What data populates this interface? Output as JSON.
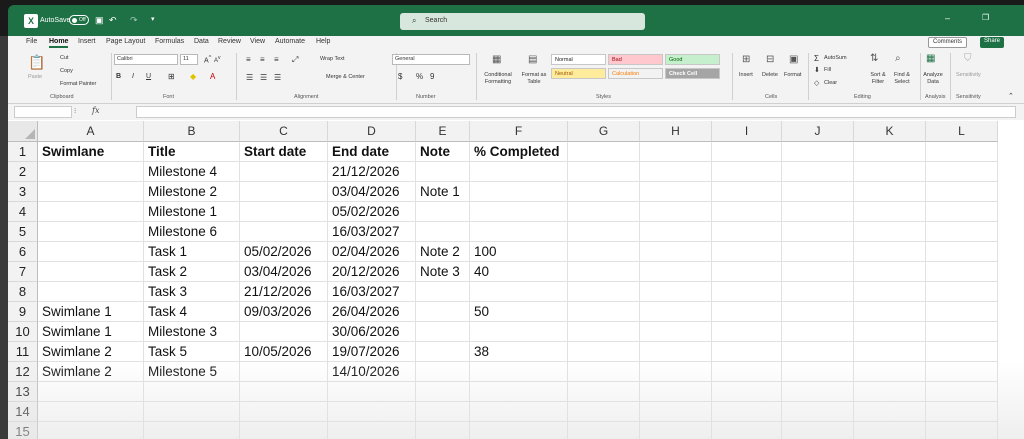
{
  "titlebar": {
    "autosave_label": "AutoSave",
    "toggle_state": "Off",
    "search_placeholder": "Search"
  },
  "menu": {
    "tabs": [
      "File",
      "Home",
      "Insert",
      "Page Layout",
      "Formulas",
      "Data",
      "Review",
      "View",
      "Automate",
      "Help"
    ],
    "active": "Home",
    "comments": "Comments",
    "share": "Share"
  },
  "ribbon": {
    "clipboard": {
      "paste": "Paste",
      "cut": "Cut",
      "copy": "Copy",
      "format_painter": "Format Painter",
      "label": "Clipboard"
    },
    "font": {
      "name": "Calibri",
      "size": "11",
      "label": "Font"
    },
    "alignment": {
      "wrap_text": "Wrap Text",
      "merge_center": "Merge & Center",
      "label": "Alignment"
    },
    "number": {
      "format": "General",
      "label": "Number"
    },
    "styles": {
      "conditional": "Conditional Formatting",
      "format_table": "Format as Table",
      "cells": [
        {
          "text": "Normal",
          "bg": "#ffffff",
          "fg": "#222222"
        },
        {
          "text": "Bad",
          "bg": "#ffc7ce",
          "fg": "#9c0006"
        },
        {
          "text": "Good",
          "bg": "#c6efce",
          "fg": "#006100"
        },
        {
          "text": "Neutral",
          "bg": "#ffeb9c",
          "fg": "#9c5700"
        },
        {
          "text": "Calculation",
          "bg": "#f2f2f2",
          "fg": "#fa7d00"
        },
        {
          "text": "Check Cell",
          "bg": "#a5a5a5",
          "fg": "#ffffff"
        }
      ],
      "label": "Styles"
    },
    "cells": {
      "insert": "Insert",
      "delete": "Delete",
      "format": "Format",
      "label": "Cells"
    },
    "editing": {
      "autosum": "AutoSum",
      "fill": "Fill",
      "clear": "Clear",
      "sort_filter": "Sort & Filter",
      "find_select": "Find & Select",
      "label": "Editing"
    },
    "analysis": {
      "analyze": "Analyze Data",
      "label": "Analysis"
    },
    "sensitivity": {
      "btn": "Sensitivity",
      "label": "Sensitivity"
    }
  },
  "formula_bar": {
    "fx": "fx",
    "value": ""
  },
  "sheet": {
    "columns": [
      "A",
      "B",
      "C",
      "D",
      "E",
      "F",
      "G",
      "H",
      "I",
      "J",
      "K",
      "L"
    ],
    "rows": [
      [
        "Swimlane",
        "Title",
        "Start date",
        "End date",
        "Note",
        "% Completed"
      ],
      [
        "",
        "Milestone 4",
        "",
        "21/12/2026",
        "",
        ""
      ],
      [
        "",
        "Milestone 2",
        "",
        "03/04/2026",
        "Note 1",
        ""
      ],
      [
        "",
        "Milestone 1",
        "",
        "05/02/2026",
        "",
        ""
      ],
      [
        "",
        "Milestone 6",
        "",
        "16/03/2027",
        "",
        ""
      ],
      [
        "",
        "Task 1",
        "05/02/2026",
        "02/04/2026",
        "Note 2",
        "100"
      ],
      [
        "",
        "Task 2",
        "03/04/2026",
        "20/12/2026",
        "Note 3",
        "40"
      ],
      [
        "",
        "Task 3",
        "21/12/2026",
        "16/03/2027",
        "",
        ""
      ],
      [
        "Swimlane 1",
        "Task 4",
        "09/03/2026",
        "26/04/2026",
        "",
        "50"
      ],
      [
        "Swimlane 1",
        "Milestone 3",
        "",
        "30/06/2026",
        "",
        ""
      ],
      [
        "Swimlane 2",
        "Task 5",
        "10/05/2026",
        "19/07/2026",
        "",
        "38"
      ],
      [
        "Swimlane 2",
        "Milestone 5",
        "",
        "14/10/2026",
        "",
        ""
      ],
      [
        "",
        "",
        "",
        "",
        "",
        ""
      ],
      [
        "",
        "",
        "",
        "",
        "",
        ""
      ],
      [
        "",
        "",
        "",
        "",
        "",
        ""
      ]
    ],
    "row_numbers": [
      "1",
      "2",
      "3",
      "4",
      "5",
      "6",
      "7",
      "8",
      "9",
      "10",
      "11",
      "12",
      "13",
      "14",
      "15"
    ]
  }
}
